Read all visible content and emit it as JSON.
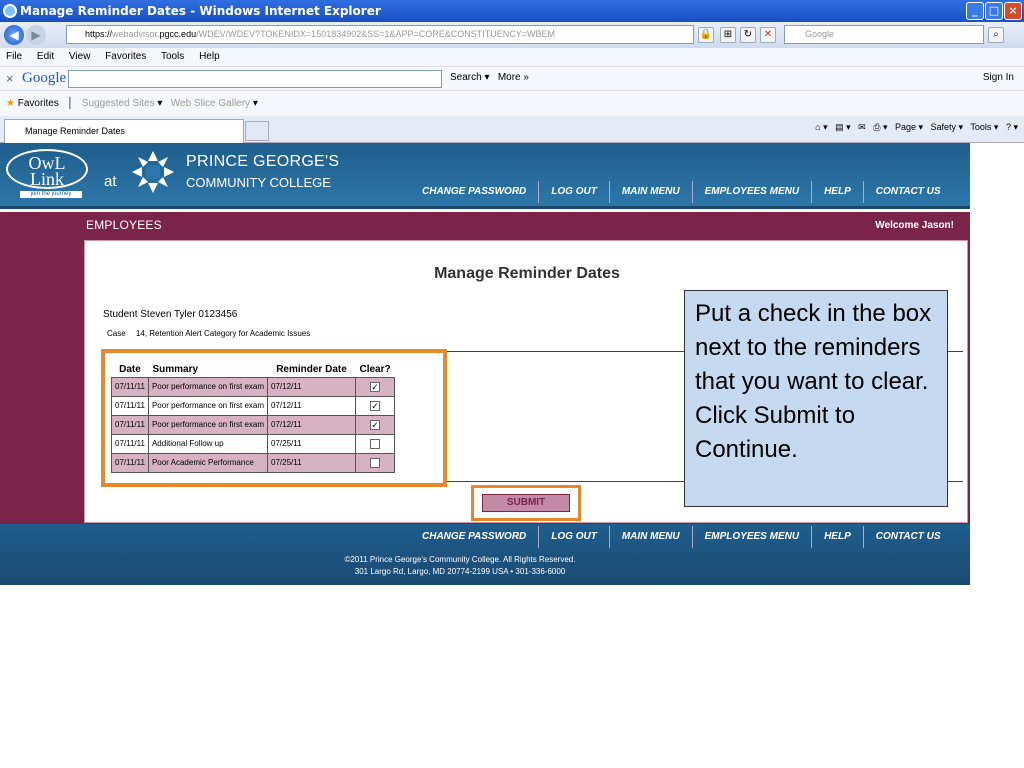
{
  "window": {
    "title": "Manage Reminder Dates - Windows Internet Explorer"
  },
  "address": {
    "scheme": "https://",
    "host_prefix": "webadvisor.",
    "host": "pgcc.edu",
    "path": "/WDEV/WDEV?TOKENIDX=1501834902&SS=1&APP=CORE&CONSTITUENCY=WBEM"
  },
  "search": {
    "placeholder": "Google"
  },
  "menu": [
    "File",
    "Edit",
    "View",
    "Favorites",
    "Tools",
    "Help"
  ],
  "google_toolbar": {
    "logo": "Google",
    "search_label": "Search",
    "more_label": "More »",
    "sign_in": "Sign In"
  },
  "favorites": {
    "label": "Favorites",
    "suggested": "Suggested Sites",
    "slice": "Web Slice Gallery"
  },
  "tab": {
    "label": "Manage Reminder Dates"
  },
  "command_bar": {
    "page": "Page",
    "safety": "Safety",
    "tools": "Tools"
  },
  "site": {
    "owl_line1": "OwL",
    "owl_line2": "Link",
    "owl_tag": "join the journey",
    "at": "at",
    "college_name": "PRINCE GEORGE'S",
    "college_sub": "COMMUNITY COLLEGE",
    "nav": [
      "CHANGE PASSWORD",
      "LOG OUT",
      "MAIN MENU",
      "EMPLOYEES MENU",
      "HELP",
      "CONTACT US"
    ],
    "section_title": "EMPLOYEES",
    "welcome": "Welcome Jason!"
  },
  "page": {
    "heading": "Manage Reminder Dates",
    "student": "Student Steven Tyler 0123456",
    "case_label": "Case",
    "case_value": "14, Retention Alert Category for Academic Issues",
    "submit": "SUBMIT"
  },
  "table": {
    "headers": [
      "Date",
      "Summary",
      "Reminder Date",
      "Clear?"
    ],
    "rows": [
      {
        "date": "07/11/11",
        "summary": "Poor performance on first exam",
        "reminder": "07/12/11",
        "checked": true
      },
      {
        "date": "07/11/11",
        "summary": "Poor performance on first exam",
        "reminder": "07/12/11",
        "checked": true
      },
      {
        "date": "07/11/11",
        "summary": "Poor performance on first exam",
        "reminder": "07/12/11",
        "checked": true
      },
      {
        "date": "07/11/11",
        "summary": "Additional Follow up",
        "reminder": "07/25/11",
        "checked": false
      },
      {
        "date": "07/11/11",
        "summary": "Poor Academic Performance",
        "reminder": "07/25/11",
        "checked": false
      }
    ]
  },
  "callout": {
    "text": "Put a check in the box next to the reminders that you want to clear. Click Submit to Continue."
  },
  "footer": {
    "copyright": "©2011 Prince George's Community College. All Rights Reserved.",
    "address": "301 Largo Rd, Largo, MD 20774-2199 USA • 301-336-6000"
  },
  "colors": {
    "maroon": "#7a2448",
    "blue": "#1f5d8c",
    "highlight": "#e8862a",
    "callout": "#c5d9f0"
  }
}
